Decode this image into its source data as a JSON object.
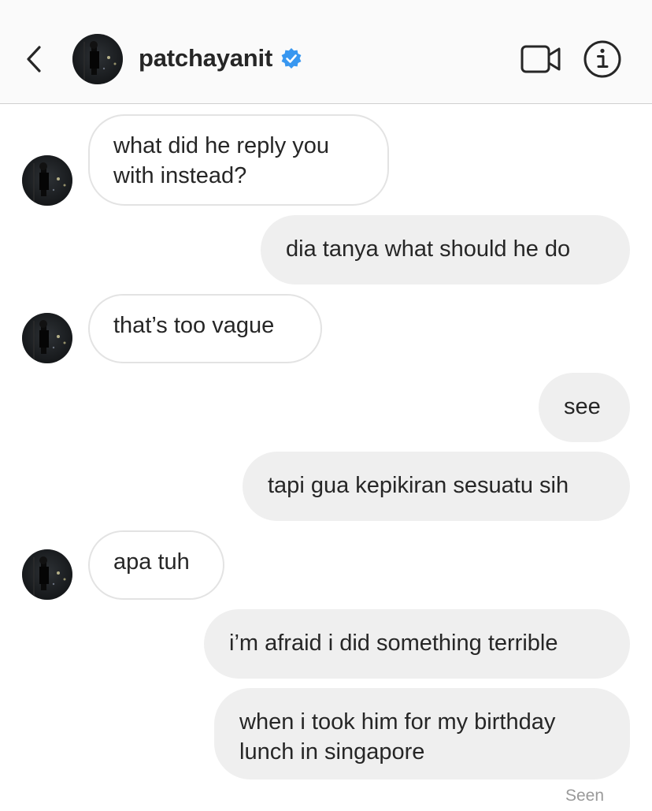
{
  "header": {
    "username": "patchayanit",
    "verified": true,
    "icons": {
      "back": "chevron-left-icon",
      "verified": "verified-badge-icon",
      "video": "video-camera-icon",
      "info": "info-icon"
    }
  },
  "messages": [
    {
      "from": "them",
      "text": "what did he reply you\nwith instead?"
    },
    {
      "from": "me",
      "text": "dia tanya what should he do"
    },
    {
      "from": "them",
      "text": "that’s too vague"
    },
    {
      "from": "me",
      "text": "see"
    },
    {
      "from": "me",
      "text": "tapi gua kepikiran sesuatu sih"
    },
    {
      "from": "them",
      "text": "apa tuh"
    },
    {
      "from": "me",
      "text": "i’m afraid i did something terrible"
    },
    {
      "from": "me",
      "text": "when i took him for my birthday\nlunch in singapore"
    }
  ],
  "status": {
    "seen_label": "Seen"
  },
  "colors": {
    "header_bg": "#fafafa",
    "outgoing_bubble": "#efefef",
    "incoming_border": "#e3e3e3",
    "verified_blue": "#3897f0",
    "text": "#262626",
    "muted": "#9a9a9a"
  }
}
